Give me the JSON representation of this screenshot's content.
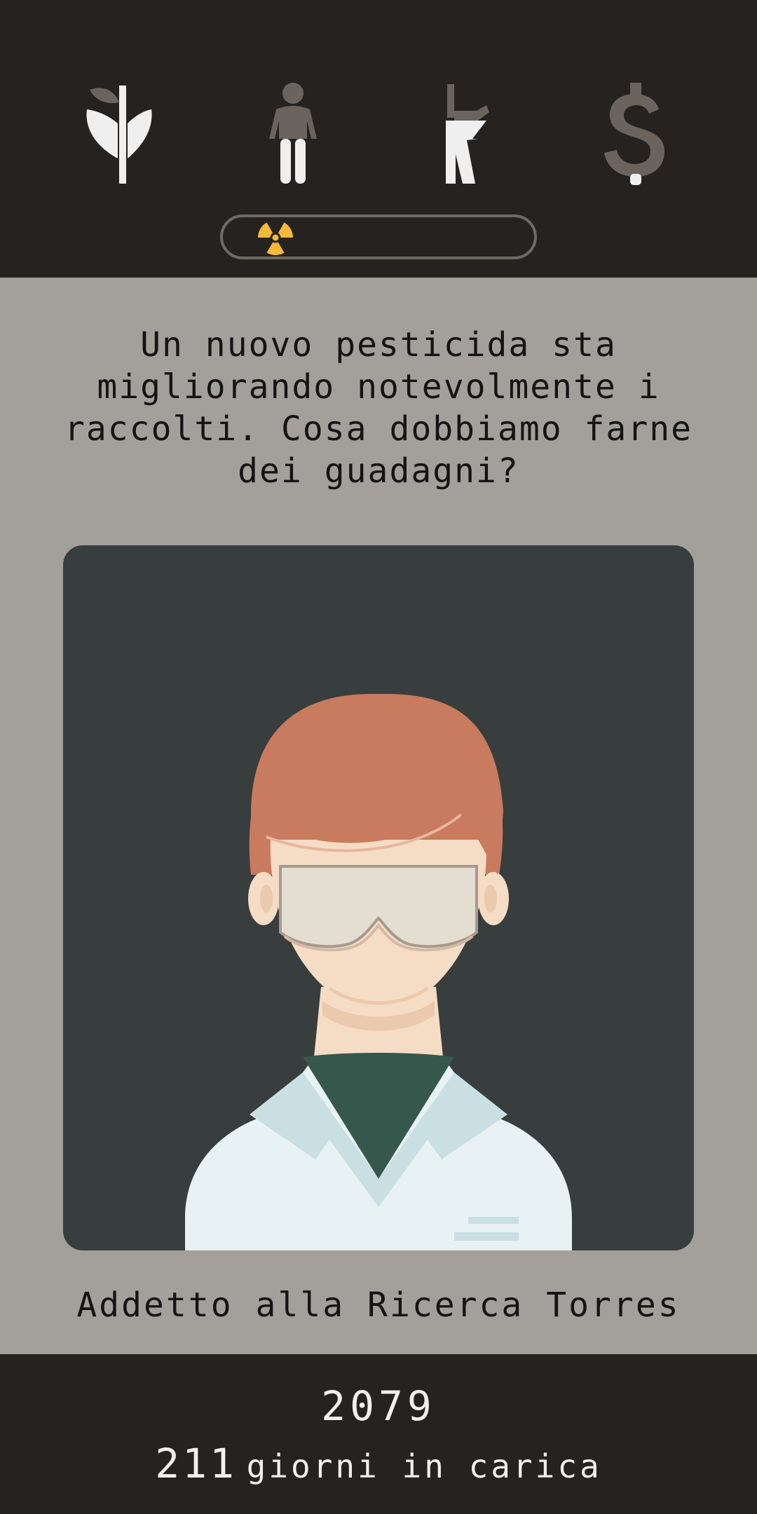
{
  "stats": [
    {
      "name": "plant-icon",
      "fill_color": "#efefef",
      "dark_color": "#6b645e"
    },
    {
      "name": "person-icon",
      "fill_color": "#efefef",
      "dark_color": "#6b645e"
    },
    {
      "name": "rifle-icon",
      "fill_color": "#efefef",
      "dark_color": "#6b645e"
    },
    {
      "name": "dollar-icon",
      "fill_color": "#efefef",
      "dark_color": "#6b645e"
    }
  ],
  "progress": {
    "icon": "radiation-icon",
    "icon_color": "#f5b93a"
  },
  "card": {
    "question": "Un nuovo pesticida sta migliorando notevolmente i raccolti. Cosa dobbiamo farne dei guadagni?",
    "character_name": "Addetto alla Ricerca Torres"
  },
  "footer": {
    "year": "2079",
    "days_count": "211",
    "days_label": "giorni in carica"
  },
  "colors": {
    "header_bg": "#252220",
    "body_bg": "#a39f9b",
    "card_bg": "#383e3d",
    "hair": "#c87b5e",
    "skin": "#f5dcc5",
    "coat": "#e8f1f3"
  }
}
